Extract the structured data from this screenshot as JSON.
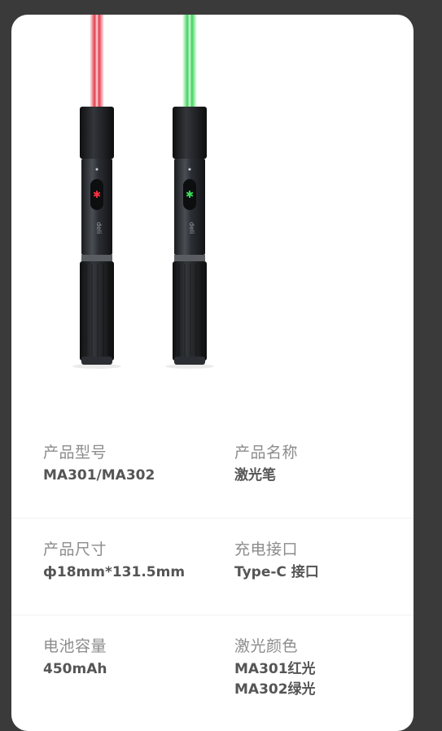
{
  "specs": [
    {
      "left": {
        "label": "产品型号",
        "value": "MA301/MA302"
      },
      "right": {
        "label": "产品名称",
        "value": "激光笔"
      }
    },
    {
      "left": {
        "label": "产品尺寸",
        "value": "ф18mm*131.5mm"
      },
      "right": {
        "label": "充电接口",
        "value": "Type-C 接口"
      }
    },
    {
      "left": {
        "label": "电池容量",
        "value": "450mAh"
      },
      "right": {
        "label": "激光颜色",
        "value": "MA301红光\nMA302绿光"
      }
    }
  ],
  "product_image": {
    "items": [
      {
        "name": "red-laser-pointer",
        "beam_color": "#e02a3a",
        "button_color": "#ff3040",
        "brand": "deli得力"
      },
      {
        "name": "green-laser-pointer",
        "beam_color": "#2ccf4a",
        "button_color": "#3be05a",
        "brand": "deli得力"
      }
    ]
  }
}
